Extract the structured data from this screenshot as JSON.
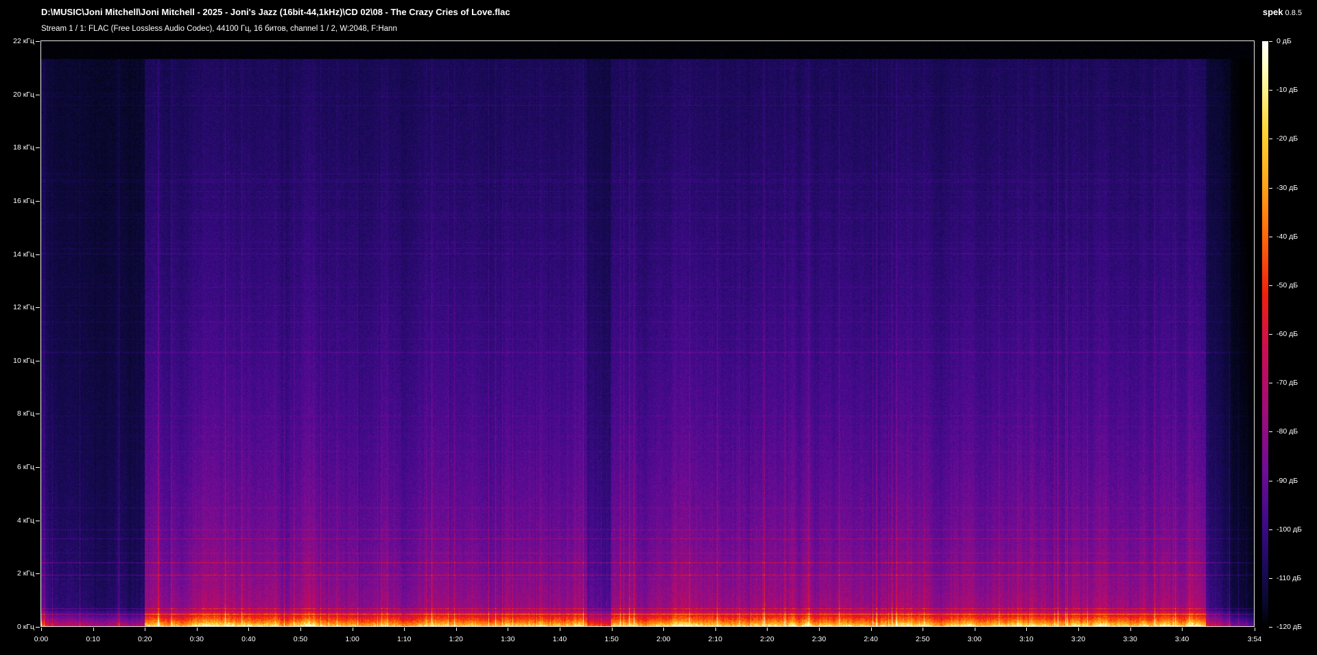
{
  "window": {
    "title": "D:\\MUSIC\\Joni Mitchell\\Joni Mitchell - 2025 - Joni's Jazz (16bit-44,1kHz)\\CD 02\\08 - The Crazy Cries of Love.flac",
    "stream_info": "Stream 1 / 1: FLAC (Free Lossless Audio Codec), 44100 Гц, 16 битов, channel 1 / 2, W:2048, F:Hann",
    "app_name": "spek",
    "app_version": "0.8.5"
  },
  "frequency_axis": {
    "labels": [
      "0 кГц",
      "2 кГц",
      "4 кГц",
      "6 кГц",
      "8 кГц",
      "10 кГц",
      "12 кГц",
      "14 кГц",
      "16 кГц",
      "18 кГц",
      "20 кГц",
      "22 кГц"
    ]
  },
  "time_axis": {
    "labels": [
      "0:00",
      "0:10",
      "0:20",
      "0:30",
      "0:40",
      "0:50",
      "1:00",
      "1:10",
      "1:20",
      "1:30",
      "1:40",
      "1:50",
      "2:00",
      "2:10",
      "2:20",
      "2:30",
      "2:40",
      "2:50",
      "3:00",
      "3:10",
      "3:20",
      "3:30",
      "3:40",
      "3:54"
    ]
  },
  "level_scale": {
    "labels": [
      "0 дБ",
      "-10 дБ",
      "-20 дБ",
      "-30 дБ",
      "-40 дБ",
      "-50 дБ",
      "-60 дБ",
      "-70 дБ",
      "-80 дБ",
      "-90 дБ",
      "-100 дБ",
      "-110 дБ",
      "-120 дБ"
    ]
  },
  "colors": {
    "background": "#000000",
    "border": "#e8e8e8",
    "text": "#ffffff"
  }
}
